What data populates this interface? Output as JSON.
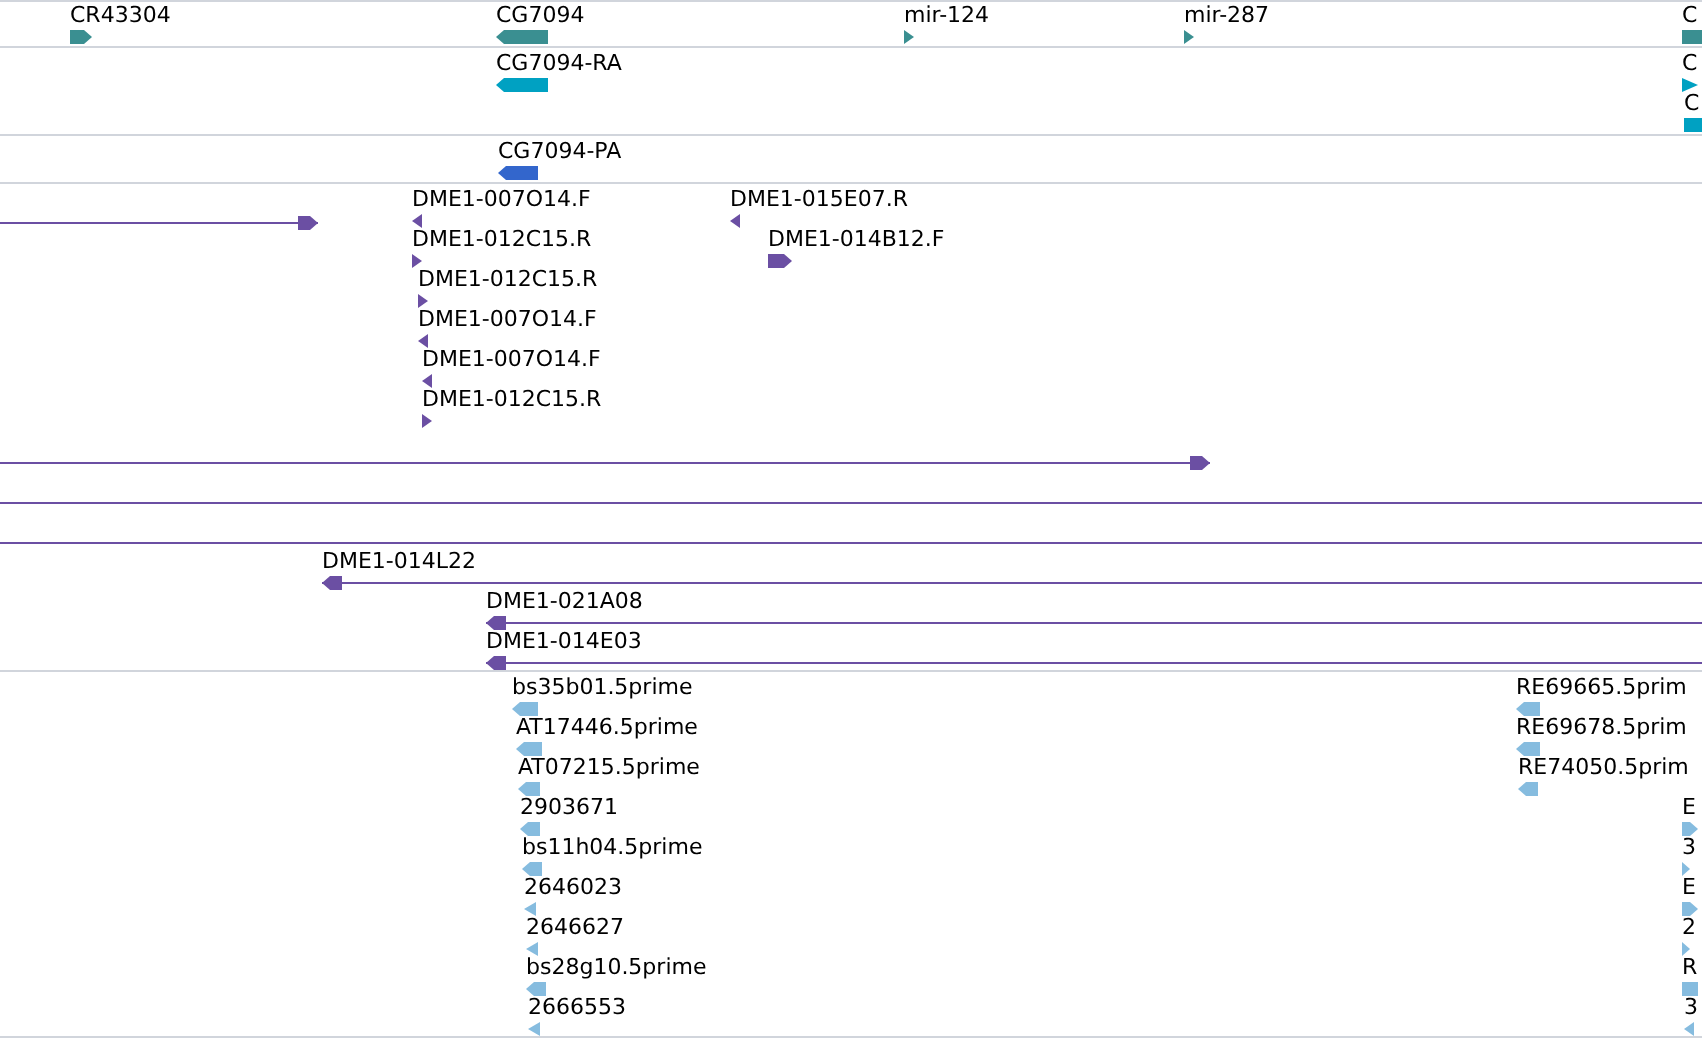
{
  "tracks": [
    {
      "color": "#3a8f91",
      "features": [
        {
          "label": "CR43304",
          "kind": "fwdbar"
        },
        {
          "label": "CG7094",
          "kind": "revbar"
        },
        {
          "label": "mir-124",
          "kind": "fwdtri"
        },
        {
          "label": "mir-287",
          "kind": "fwdtri"
        },
        {
          "label": "C",
          "kind": "bar"
        }
      ]
    },
    {
      "color": "#00a1c2",
      "features": [
        {
          "label": "CG7094-RA",
          "kind": "revbar"
        },
        {
          "label": "C",
          "kind": "fwdtri"
        },
        {
          "label": "C",
          "kind": "bar"
        }
      ]
    },
    {
      "color": "#3366cc",
      "features": [
        {
          "label": "CG7094-PA",
          "kind": "revbar"
        }
      ]
    },
    {
      "color": "#6b4fa3",
      "features": [
        {
          "kind": "fwdline"
        },
        {
          "label": "DME1-007O14.F",
          "kind": "revtri"
        },
        {
          "label": "DME1-012C15.R",
          "kind": "fwdtri"
        },
        {
          "label": "DME1-012C15.R",
          "kind": "fwdtri"
        },
        {
          "label": "DME1-007O14.F",
          "kind": "revtri"
        },
        {
          "label": "DME1-007O14.F",
          "kind": "revtri"
        },
        {
          "label": "DME1-012C15.R",
          "kind": "fwdtri"
        },
        {
          "label": "DME1-015E07.R",
          "kind": "revtri"
        },
        {
          "label": "DME1-014B12.F",
          "kind": "fwdbar"
        },
        {
          "kind": "fwdline"
        },
        {
          "kind": "line"
        },
        {
          "kind": "line"
        },
        {
          "label": "DME1-014L22",
          "kind": "revline"
        },
        {
          "label": "DME1-021A08",
          "kind": "revline"
        },
        {
          "label": "DME1-014E03",
          "kind": "revline"
        }
      ]
    },
    {
      "color": "#86bcdf",
      "features": [
        {
          "label": "bs35b01.5prime",
          "kind": "revbar"
        },
        {
          "label": "AT17446.5prime",
          "kind": "revbar"
        },
        {
          "label": "AT07215.5prime",
          "kind": "revbar"
        },
        {
          "label": "2903671",
          "kind": "revbar"
        },
        {
          "label": "bs11h04.5prime",
          "kind": "revbar"
        },
        {
          "label": "2646023",
          "kind": "revtri"
        },
        {
          "label": "2646627",
          "kind": "revtri"
        },
        {
          "label": "bs28g10.5prime",
          "kind": "revbar"
        },
        {
          "label": "2666553",
          "kind": "revtri"
        },
        {
          "label": "RE69665.5prim",
          "kind": "revbar"
        },
        {
          "label": "RE69678.5prim",
          "kind": "revbar"
        },
        {
          "label": "RE74050.5prim",
          "kind": "revbar"
        },
        {
          "label": "E",
          "kind": "fwdbar"
        },
        {
          "label": "3",
          "kind": "fwdtri"
        },
        {
          "label": "E",
          "kind": "fwdbar"
        },
        {
          "label": "2",
          "kind": "fwdtri"
        },
        {
          "label": "R",
          "kind": "bar"
        },
        {
          "label": "3",
          "kind": "revtri"
        }
      ]
    }
  ]
}
